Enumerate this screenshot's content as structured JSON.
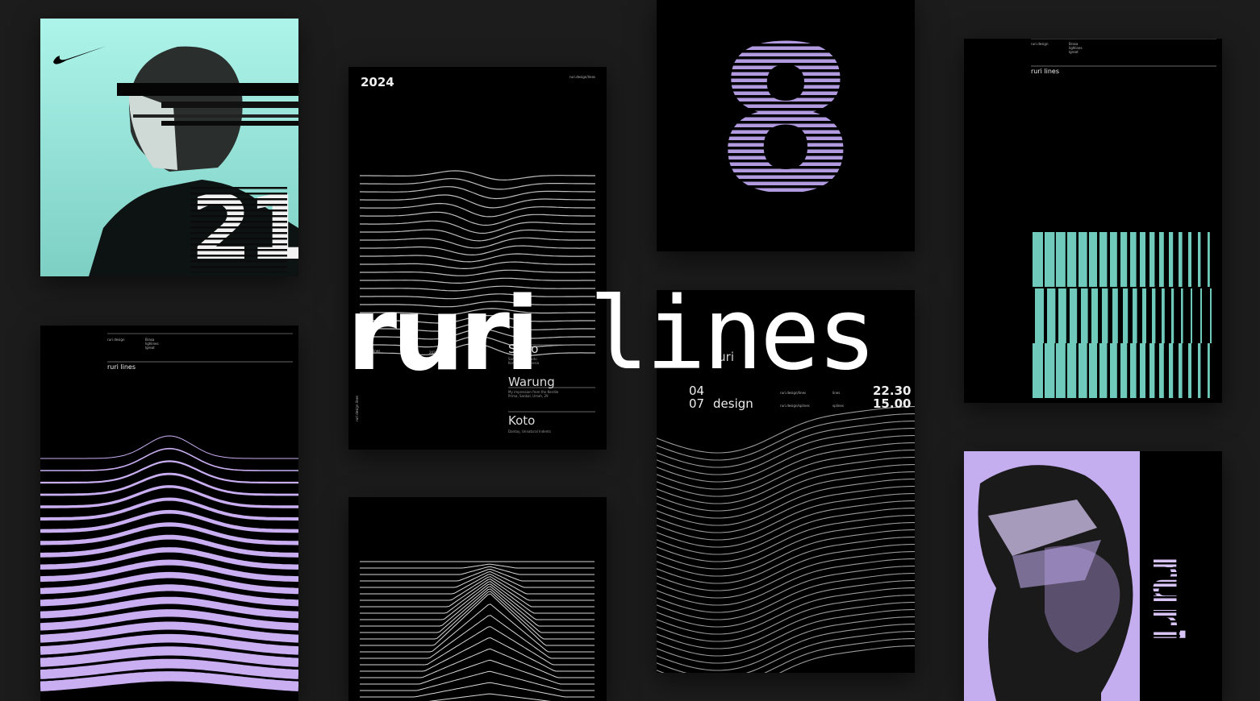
{
  "hero": {
    "word_bold": "ruri",
    "word_light": "lines"
  },
  "colors": {
    "background": "#1c1c1c",
    "mint": "#9ff0e4",
    "lavender": "#c9aef2",
    "black": "#000000"
  },
  "posters": {
    "nike": {
      "logo": "swoosh-icon",
      "number": "21"
    },
    "waves": {
      "year": "2024",
      "header_tag": "ruri.design/lines",
      "side_text": "ruri design lines",
      "col_left": "lines",
      "col_mid": "2024",
      "items": [
        {
          "title": "Simo",
          "sub": "Samsung & Photo\nKomodo, Indonesia"
        },
        {
          "title": "Warung",
          "sub": "My impression from the Kerdile\nPrima, Sanbal, Umah, 29"
        },
        {
          "title": "Koto",
          "sub": "Dantay, Unnatural Indents"
        }
      ]
    },
    "eight": {
      "glyph": "8"
    },
    "lavender_lines": {
      "brand": "ruri design",
      "meta": "Brasa\nlighlines\nlgreat",
      "title": "ruri lines"
    },
    "schedule": {
      "title": "ruri",
      "rows": [
        {
          "day": "04",
          "name": "",
          "link": "ruri.design/lines",
          "tag": "lines",
          "time": "22.30"
        },
        {
          "day": "07",
          "name": "design",
          "link": "ruri.design/splines",
          "tag": "splines",
          "time": "15.00"
        }
      ]
    },
    "mint_bars": {
      "brand": "ruri.design",
      "meta": "Brasa\nlighlines\nlgreat",
      "title": "ruri lines"
    },
    "portrait": {
      "letters": "ruri"
    }
  }
}
